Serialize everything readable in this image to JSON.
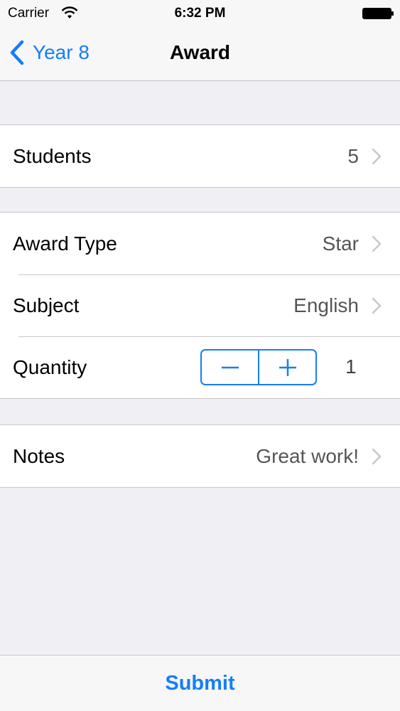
{
  "status_bar": {
    "carrier": "Carrier",
    "time": "6:32 PM"
  },
  "nav": {
    "back_label": "Year 8",
    "title": "Award"
  },
  "sections": {
    "students": {
      "label": "Students",
      "value": "5"
    },
    "award_type": {
      "label": "Award Type",
      "value": "Star"
    },
    "subject": {
      "label": "Subject",
      "value": "English"
    },
    "quantity": {
      "label": "Quantity",
      "value": "1"
    },
    "notes": {
      "label": "Notes",
      "value": "Great work!"
    }
  },
  "toolbar": {
    "submit_label": "Submit"
  },
  "colors": {
    "accent": "#147efb",
    "background": "#efeff4",
    "separator": "#c8c7cc"
  }
}
